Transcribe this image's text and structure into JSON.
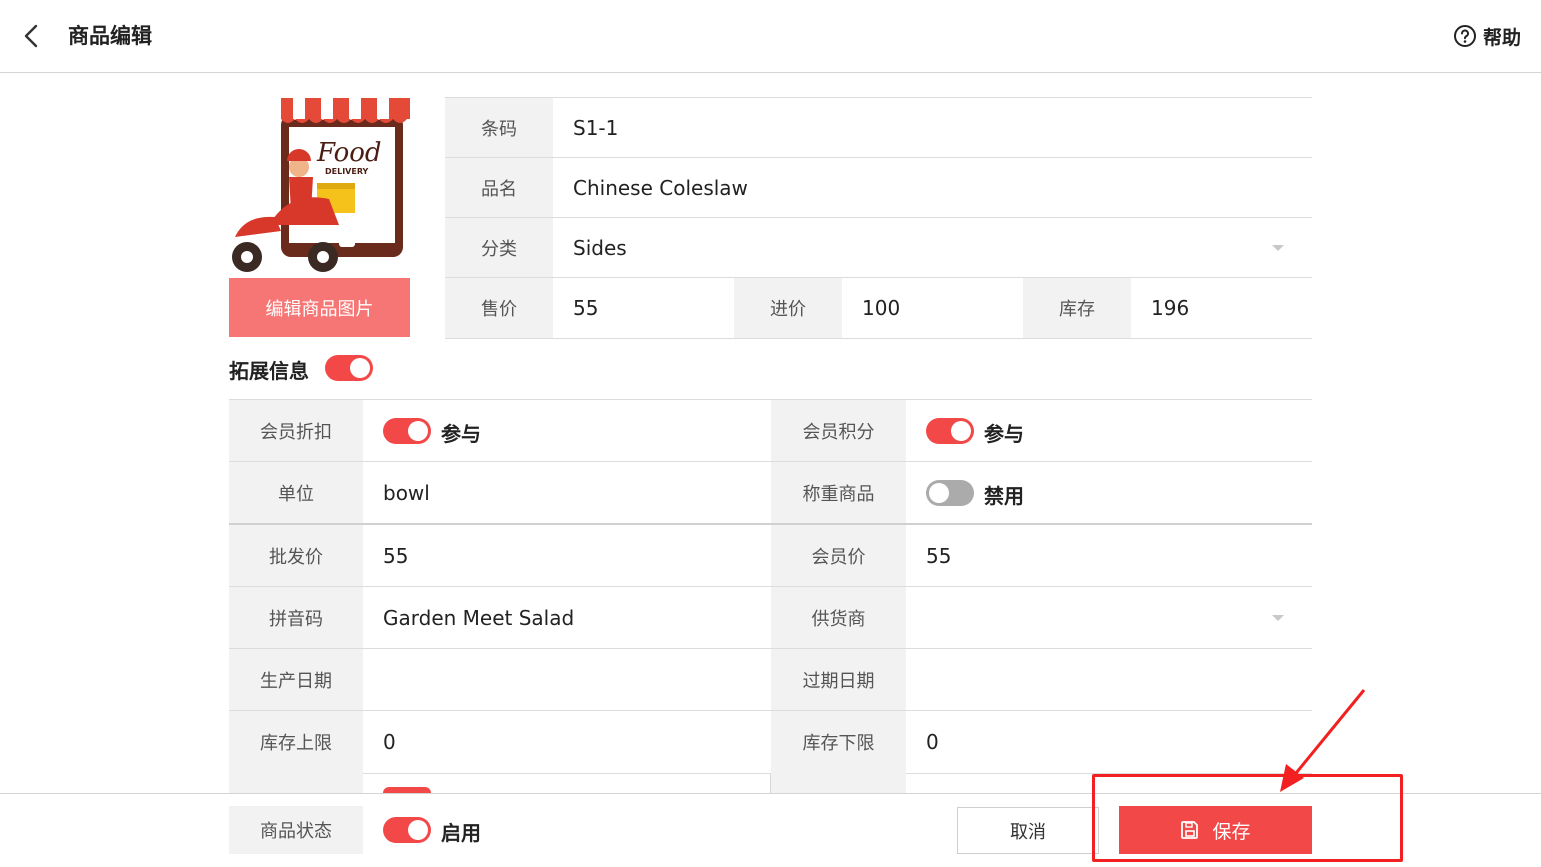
{
  "header": {
    "title": "商品编辑",
    "help_label": "帮助"
  },
  "image": {
    "edit_button_label": "编辑商品图片",
    "logo_text": "Food",
    "logo_subtext": "DELIVERY"
  },
  "basic": {
    "barcode_label": "条码",
    "barcode_value": "S1-1",
    "name_label": "品名",
    "name_value": "Chinese Coleslaw",
    "category_label": "分类",
    "category_value": "Sides",
    "price_label": "售价",
    "price_value": "55",
    "cost_label": "进价",
    "cost_value": "100",
    "stock_label": "库存",
    "stock_value": "196"
  },
  "extended": {
    "title": "拓展信息",
    "toggle_on": true,
    "member_discount_label": "会员折扣",
    "member_discount_state": "参与",
    "member_points_label": "会员积分",
    "member_points_state": "参与",
    "unit_label": "单位",
    "unit_value": "bowl",
    "weighed_label": "称重商品",
    "weighed_state": "禁用",
    "wholesale_label": "批发价",
    "wholesale_value": "55",
    "member_price_label": "会员价",
    "member_price_value": "55",
    "pinyin_label": "拼音码",
    "pinyin_value": "Garden Meet Salad",
    "supplier_label": "供货商",
    "supplier_value": "",
    "production_date_label": "生产日期",
    "production_date_value": "",
    "expiry_date_label": "过期日期",
    "expiry_date_value": "",
    "stock_upper_label": "库存上限",
    "stock_upper_value": "0",
    "stock_lower_label": "库存下限",
    "stock_lower_value": "0"
  },
  "footer": {
    "status_label": "商品状态",
    "status_state": "启用",
    "cancel_label": "取消",
    "save_label": "保存"
  },
  "colors": {
    "accent": "#f24848",
    "image_button": "#f67676",
    "highlight": "#f22020"
  }
}
